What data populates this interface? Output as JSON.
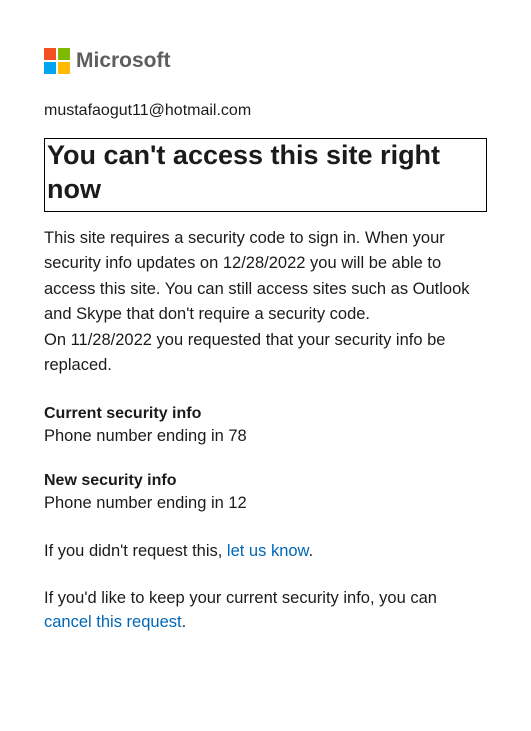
{
  "header": {
    "brand": "Microsoft"
  },
  "account": {
    "email": "mustafaogut11@hotmail.com"
  },
  "title": "You can't access this site right now",
  "description": "This site requires a security code to sign in. When your security info updates on 12/28/2022 you will be able to access this site. You can still access sites such as Outlook and Skype that don't require a security code.\nOn 11/28/2022 you requested that your security info be replaced.",
  "current_info": {
    "heading": "Current security info",
    "value": "Phone number ending in 78"
  },
  "new_info": {
    "heading": "New security info",
    "value": "Phone number ending in 12"
  },
  "not_requested": {
    "prefix": "If you didn't request this, ",
    "link": "let us know",
    "suffix": "."
  },
  "keep_current": {
    "prefix": "If you'd like to keep your current security info, you can ",
    "link": "cancel this request",
    "suffix": "."
  }
}
